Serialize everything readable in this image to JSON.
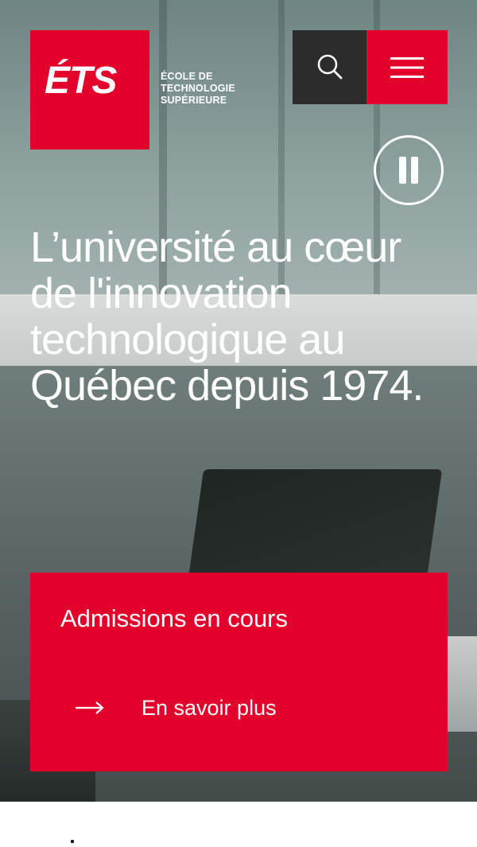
{
  "header": {
    "logo_mark": "ÉTS",
    "logo_lines": [
      "ÉCOLE DE",
      "TECHNOLOGIE",
      "SUPÉRIEURE"
    ],
    "search_icon": "search-icon",
    "menu_icon": "hamburger-menu-icon"
  },
  "hero": {
    "pause_icon": "pause-icon",
    "headline": "L’université au cœur de l'innovation technologique au Québec depuis 1974."
  },
  "cta": {
    "title": "Admissions en cours",
    "link_label": "En savoir plus",
    "link_icon": "arrow-right-icon"
  },
  "colors": {
    "brand_red": "#e3002b",
    "search_bg": "#2c2c2c",
    "text_on_dark": "#ffffff"
  }
}
